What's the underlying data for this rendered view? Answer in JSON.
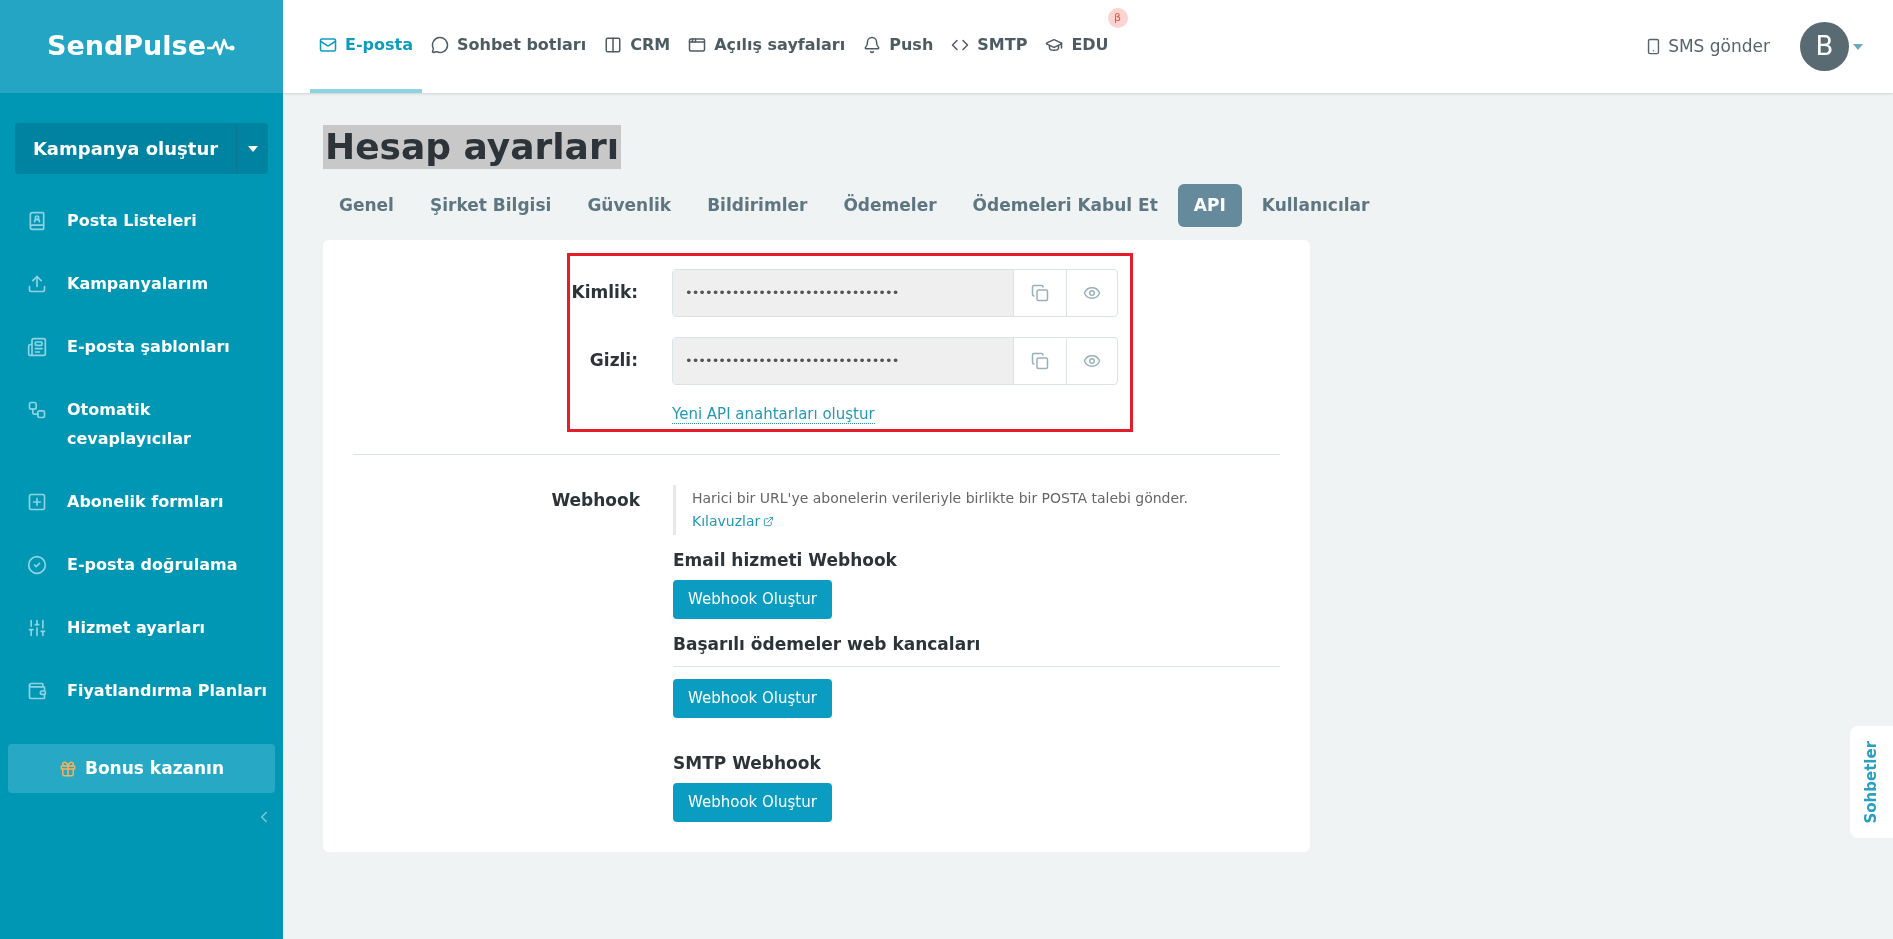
{
  "logo": {
    "text": "SendPulse"
  },
  "nav": [
    {
      "label": "E-posta",
      "selected": true
    },
    {
      "label": "Sohbet botları",
      "selected": false
    },
    {
      "label": "CRM",
      "selected": false
    },
    {
      "label": "Açılış sayfaları",
      "selected": false
    },
    {
      "label": "Push",
      "selected": false
    },
    {
      "label": "SMTP",
      "selected": false
    },
    {
      "label": "EDU",
      "selected": false,
      "badge": "β"
    }
  ],
  "header_right": {
    "sms": "SMS gönder",
    "avatar": "B"
  },
  "sidebar": {
    "create_button": "Kampanya oluştur",
    "items": [
      {
        "label": "Posta Listeleri"
      },
      {
        "label": "Kampanyalarım"
      },
      {
        "label": "E-posta şablonları"
      },
      {
        "label": "Otomatik cevaplayıcılar"
      },
      {
        "label": "Abonelik formları"
      },
      {
        "label": "E-posta doğrulama"
      },
      {
        "label": "Hizmet ayarları"
      },
      {
        "label": "Fiyatlandırma Planları"
      }
    ],
    "bonus": "Bonus kazanın"
  },
  "page": {
    "title": "Hesap ayarları",
    "title_highlighted": true,
    "tabs": [
      {
        "label": "Genel",
        "selected": false
      },
      {
        "label": "Şirket Bilgisi",
        "selected": false
      },
      {
        "label": "Güvenlik",
        "selected": false
      },
      {
        "label": "Bildirimler",
        "selected": false
      },
      {
        "label": "Ödemeler",
        "selected": false
      },
      {
        "label": "Ödemeleri Kabul Et",
        "selected": false
      },
      {
        "label": "API",
        "selected": true
      },
      {
        "label": "Kullanıcılar",
        "selected": false
      }
    ],
    "api_keys": [
      {
        "label": "Kimlik:",
        "value": "••••••••••••••••••••••••••••••••"
      },
      {
        "label": "Gizli:",
        "value": "••••••••••••••••••••••••••••••••"
      }
    ],
    "new_keys_link": "Yeni API anahtarları oluştur",
    "webhook": {
      "label": "Webhook",
      "description": "Harici bir URL'ye abonelerin verileriyle birlikte bir POSTA talebi gönder.",
      "guide_link": "Kılavuzlar",
      "sections": [
        {
          "title": "Email hizmeti Webhook",
          "button": "Webhook Oluştur",
          "divider": false
        },
        {
          "title": "Başarılı ödemeler web kancaları",
          "button": "Webhook Oluştur",
          "divider": true
        },
        {
          "title": "SMTP Webhook",
          "button": "Webhook Oluştur",
          "divider": false
        }
      ]
    }
  },
  "chat_tab": "Sohbetler"
}
